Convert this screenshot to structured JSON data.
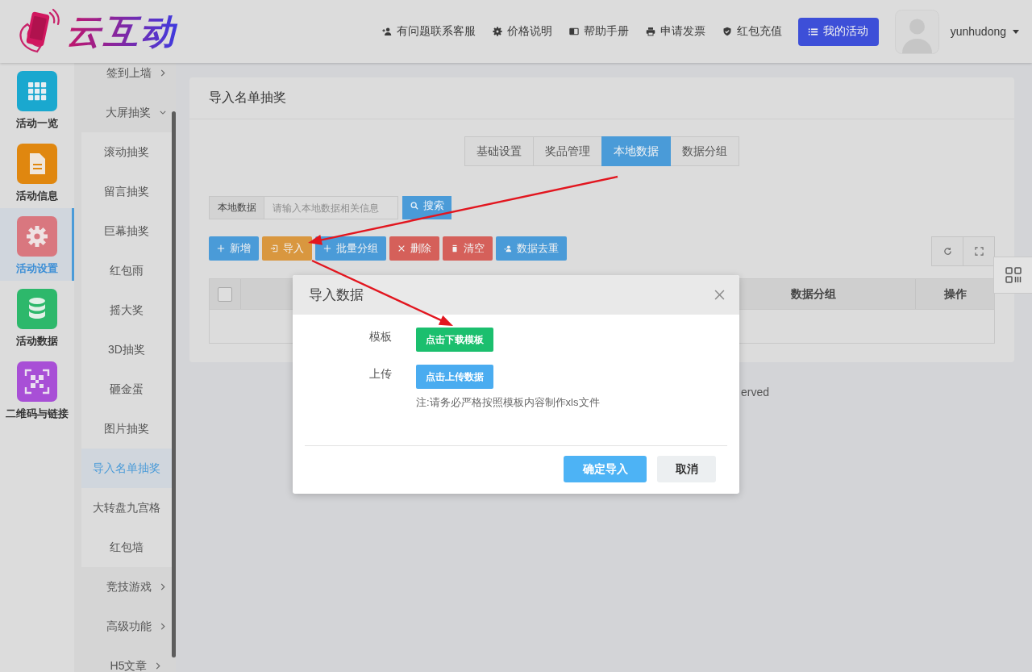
{
  "header": {
    "logo": "云互动",
    "links": [
      "有问题联系客服",
      "价格说明",
      "帮助手册",
      "申请发票",
      "红包充值"
    ],
    "primary_button": "我的活动",
    "username": "yunhudong"
  },
  "main_nav": [
    {
      "label": "活动一览",
      "color": "#1aa8cf",
      "selected": false
    },
    {
      "label": "活动信息",
      "color": "#e0870f",
      "selected": false
    },
    {
      "label": "活动设置",
      "color": "#d9777f",
      "selected": true
    },
    {
      "label": "活动数据",
      "color": "#2db86b",
      "selected": false
    },
    {
      "label": "二维码与链接",
      "color": "#a84fd6",
      "selected": false
    }
  ],
  "sub_nav": [
    {
      "label": "签到上墙",
      "expanded": false
    },
    {
      "label": "大屏抽奖",
      "expanded": true,
      "children": [
        {
          "label": "滚动抽奖",
          "selected": false
        },
        {
          "label": "留言抽奖",
          "selected": false
        },
        {
          "label": "巨幕抽奖",
          "selected": false
        },
        {
          "label": "红包雨",
          "selected": false
        },
        {
          "label": "摇大奖",
          "selected": false
        },
        {
          "label": "3D抽奖",
          "selected": false
        },
        {
          "label": "砸金蛋",
          "selected": false
        },
        {
          "label": "图片抽奖",
          "selected": false
        },
        {
          "label": "导入名单抽奖",
          "selected": true
        },
        {
          "label": "大转盘九宫格",
          "selected": false
        },
        {
          "label": "红包墙",
          "selected": false
        }
      ]
    },
    {
      "label": "竞技游戏",
      "expanded": false
    },
    {
      "label": "高级功能",
      "expanded": false
    },
    {
      "label": "H5文章",
      "expanded": false
    }
  ],
  "card": {
    "title": "导入名单抽奖",
    "tabs": [
      {
        "label": "基础设置",
        "selected": false
      },
      {
        "label": "奖品管理",
        "selected": false
      },
      {
        "label": "本地数据",
        "selected": true
      },
      {
        "label": "数据分组",
        "selected": false
      }
    ],
    "search": {
      "label": "本地数据",
      "placeholder": "请输入本地数据相关信息",
      "button": "搜索"
    },
    "toolbar": [
      {
        "label": "新增",
        "kind": "add"
      },
      {
        "label": "导入",
        "kind": "import"
      },
      {
        "label": "批量分组",
        "kind": "group"
      },
      {
        "label": "删除",
        "kind": "delete"
      },
      {
        "label": "清空",
        "kind": "clear"
      },
      {
        "label": "数据去重",
        "kind": "dedupe"
      }
    ],
    "table": {
      "select_all": {
        "checked": false
      },
      "columns": [
        "数据分组",
        "操作"
      ]
    }
  },
  "footer": "erved",
  "modal": {
    "title": "导入数据",
    "rows": [
      {
        "label": "模板",
        "button": "点击下载模板",
        "kind": "download"
      },
      {
        "label": "上传",
        "button": "点击上传数据",
        "kind": "upload",
        "note": "注:请务必严格按照模板内容制作xls文件"
      }
    ],
    "buttons": [
      {
        "label": "确定导入",
        "kind": "primary"
      },
      {
        "label": "取消",
        "kind": "default"
      }
    ]
  }
}
